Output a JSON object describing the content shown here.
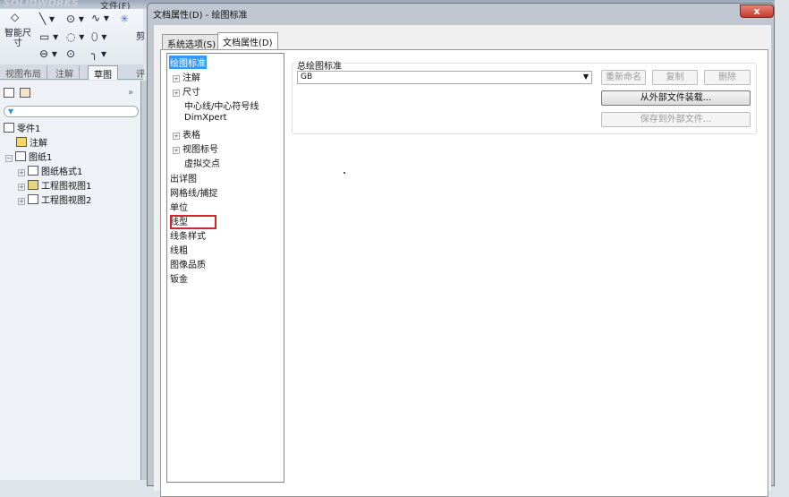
{
  "app": {
    "logo": "SOLIDWORKS",
    "menu_file": "文件(F)"
  },
  "toolbar": {
    "smart_dimension": "智能尺寸",
    "cut_label": "剪"
  },
  "cm_tabs": [
    "视图布局",
    "注解",
    "草图",
    "评"
  ],
  "feature_tree": {
    "root": "零件1",
    "items": [
      {
        "label": "注解"
      },
      {
        "label": "图纸1"
      },
      {
        "label": "图纸格式1"
      },
      {
        "label": "工程图视图1"
      },
      {
        "label": "工程图视图2"
      }
    ],
    "expand": "»"
  },
  "dialog": {
    "title": "文档属性(D) - 绘图标准",
    "close": "x",
    "tabs": [
      "系统选项(S)",
      "文档属性(D)"
    ],
    "tree": [
      "绘图标准",
      "注解",
      "尺寸",
      "中心线/中心符号线",
      "DimXpert",
      "表格",
      "视图标号",
      "虚拟交点",
      "出详图",
      "网格线/捕捉",
      "单位",
      "线型",
      "线条样式",
      "线粗",
      "图像品质",
      "钣金"
    ],
    "group_label": "总绘图标准",
    "standard_value": "GB",
    "buttons": {
      "rename": "重新命名",
      "copy": "复制",
      "delete": "删除",
      "load": "从外部文件装载...",
      "save": "保存到外部文件..."
    }
  },
  "colors": {
    "selection": "#3399ff",
    "highlight_box": "#d0262c"
  }
}
